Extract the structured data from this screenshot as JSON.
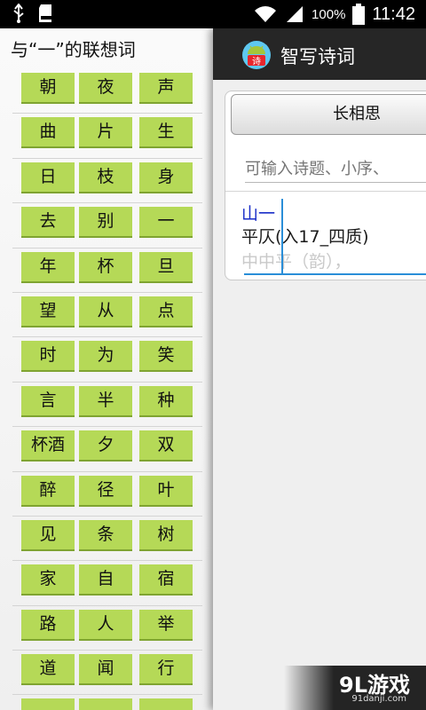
{
  "status_bar": {
    "battery_percent": "100%",
    "time": "11:42",
    "icons": [
      "usb-icon",
      "sd-card-icon",
      "wifi-icon",
      "signal-icon",
      "battery-icon"
    ]
  },
  "left_panel": {
    "title": "与“一”的联想词",
    "rows": [
      [
        "朝",
        "夜",
        "声"
      ],
      [
        "曲",
        "片",
        "生"
      ],
      [
        "日",
        "枝",
        "身"
      ],
      [
        "去",
        "别",
        "一"
      ],
      [
        "年",
        "杯",
        "旦"
      ],
      [
        "望",
        "从",
        "点"
      ],
      [
        "时",
        "为",
        "笑"
      ],
      [
        "言",
        "半",
        "种"
      ],
      [
        "杯酒",
        "夕",
        "双"
      ],
      [
        "醉",
        "径",
        "叶"
      ],
      [
        "见",
        "条",
        "树"
      ],
      [
        "家",
        "自",
        "宿"
      ],
      [
        "路",
        "人",
        "举"
      ],
      [
        "道",
        "闻",
        "行"
      ]
    ]
  },
  "app": {
    "title": "智写诗词",
    "icon_text": "诗"
  },
  "editor_card": {
    "title_button": "长相思",
    "input_placeholder": "可输入诗题、小序、",
    "line1": "山一",
    "line2": "平仄(入17_四质)",
    "line3": "中中平（韵），"
  },
  "watermark": {
    "main": "9L游戏",
    "sub": "91danji.com"
  },
  "colors": {
    "cell_green": "#b5d957",
    "action_bar": "#262626",
    "editor_blue": "#1a2ec8",
    "cursor_blue": "#2a8ed8"
  }
}
